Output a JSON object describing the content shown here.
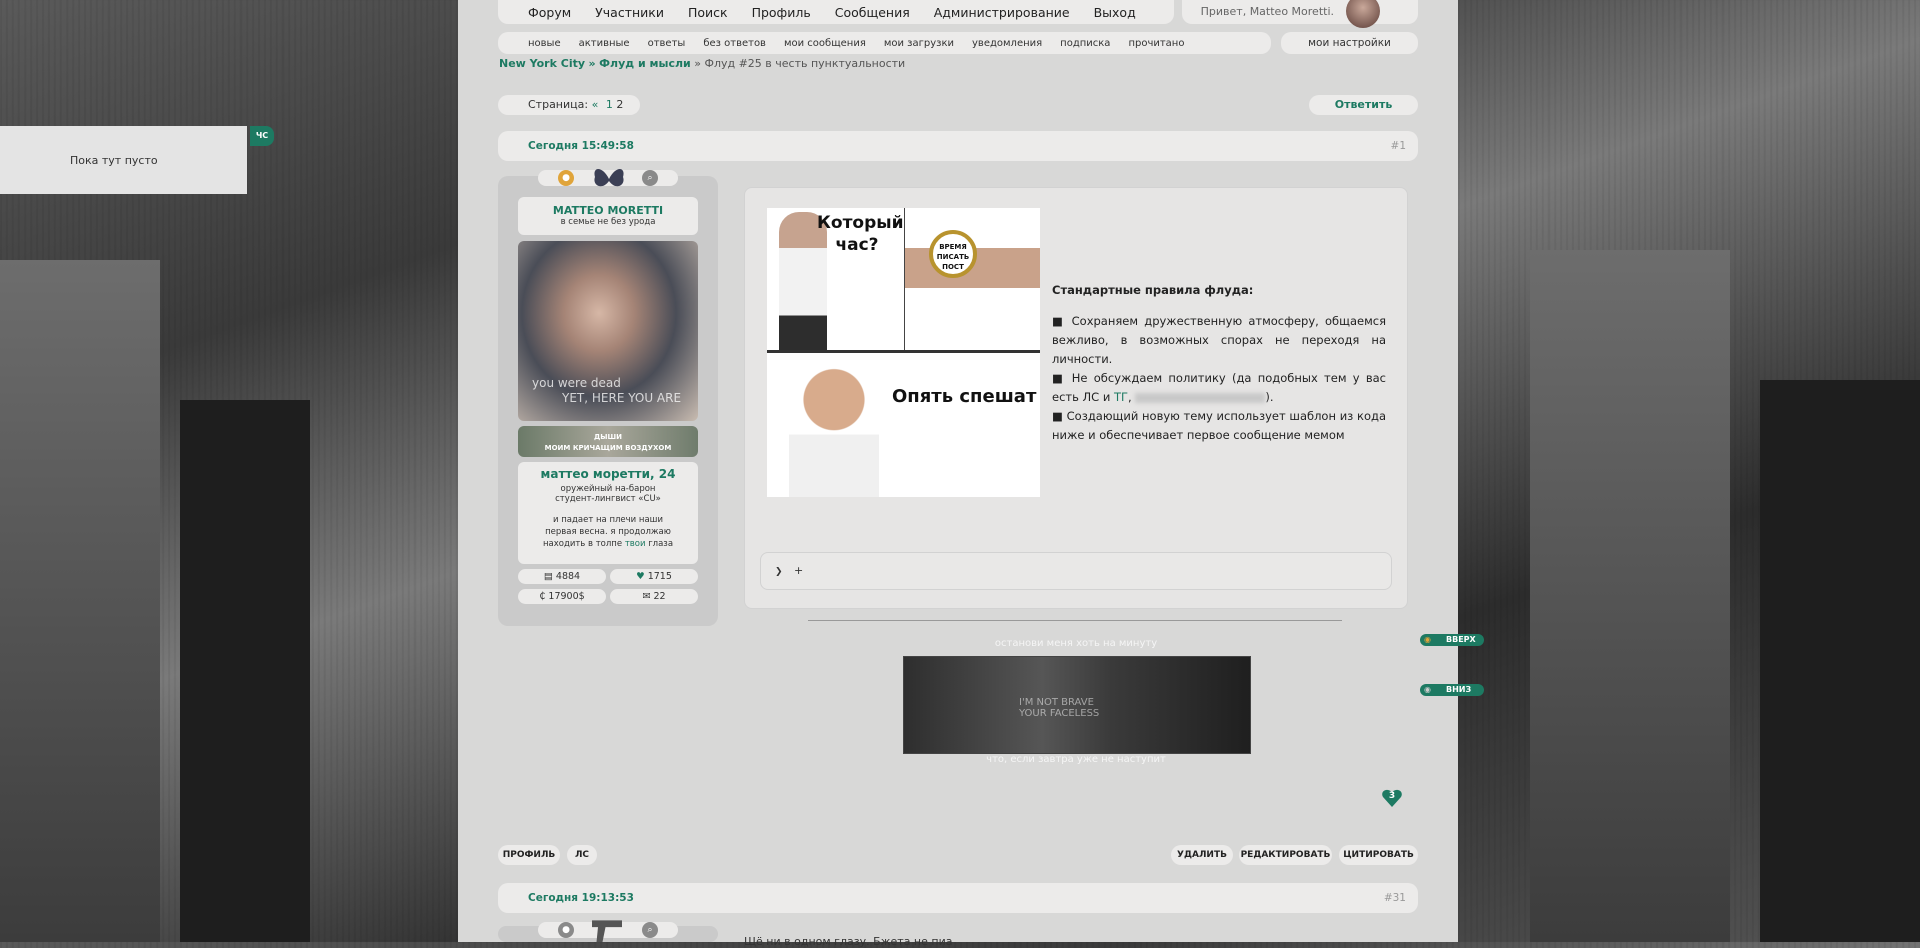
{
  "nav": {
    "items": [
      "Форум",
      "Участники",
      "Поиск",
      "Профиль",
      "Сообщения",
      "Администрирование",
      "Выход"
    ],
    "greeting": "Привет, Matteo Moretti."
  },
  "subnav": {
    "items": [
      "новые",
      "активные",
      "ответы",
      "без ответов",
      "мои сообщения",
      "мои загрузки",
      "уведомления",
      "подписка",
      "прочитано"
    ],
    "settings": "мои настройки"
  },
  "breadcrumb": {
    "forum": "New York City",
    "sep1": "»",
    "section": "Флуд и мысли",
    "sep2": "»",
    "topic": "Флуд #25 в честь пунктуальности"
  },
  "pager": {
    "label": "Страница:",
    "prev": "«",
    "p1": "1",
    "p2": "2"
  },
  "reply_label": "Ответить",
  "sidebar": {
    "empty": "Пока тут пусто",
    "tab": "ЧС"
  },
  "post1": {
    "date": "Сегодня 15:49:58",
    "num": "#1"
  },
  "profile": {
    "name": "MATTEO MORETTI",
    "tagline": "в семье не без урода",
    "avatar_text1": "you were dead",
    "avatar_text2": "YET, HERE YOU ARE",
    "band_line1": "ДЫШИ",
    "band_line2": "МОИМ КРИЧАЩИМ ВОЗДУХОМ",
    "rp_name": "маттео моретти, 24",
    "role1": "оружейный на-барон",
    "role2": "студент-лингвист «CU»",
    "quote_a": "и падает на плечи наши первая весна. я продолжаю находить в толпе",
    "quote_hl": "твои",
    "quote_b": "глаза",
    "posts": "4884",
    "likes": "1715",
    "money": "17900$",
    "pm": "22"
  },
  "meme": {
    "top_left": "Который час?",
    "watch": "ВРЕМЯ ПИСАТЬ ПОСТ",
    "bottom": "Опять спешат"
  },
  "rules": {
    "title": "Стандартные правила флуда:",
    "r1": "■  Сохраняем дружественную атмосферу, общаемся вежливо, в возможных спорах не переходя на личности.",
    "r2a": "■ Не обсуждаем политику (да подобных тем у вас есть ЛС и",
    "r2b": "ТГ",
    "r2c": ").",
    "r3": "■  Создающий новую тему использует шаблон из кода ниже и обеспечивает первое сообщение мемом"
  },
  "spoiler": {
    "arrow": "❯",
    "text": "+"
  },
  "signature": {
    "top": "останови меня хоть на минуту",
    "img_text1": "I'M NOT BRAVE",
    "img_text2": "YOUR FACELESS",
    "bottom": "что, если завтра уже не наступит"
  },
  "like_count": "3",
  "post_buttons": {
    "profile": "ПРОФИЛЬ",
    "pm": "ЛС",
    "delete": "УДАЛИТЬ",
    "edit": "РЕДАКТИРОВАТЬ",
    "quote": "ЦИТИРОВАТЬ"
  },
  "post2": {
    "date": "Сегодня 19:13:53",
    "num": "#31",
    "preview": "Щё ни в одном глазу. Бжета не пиа"
  },
  "scroll": {
    "up": "ВВЕРХ",
    "down": "ВНИЗ"
  },
  "colors": {
    "accent": "#1d7a62",
    "panel": "#d8d8d7",
    "pill": "#ecebea"
  }
}
